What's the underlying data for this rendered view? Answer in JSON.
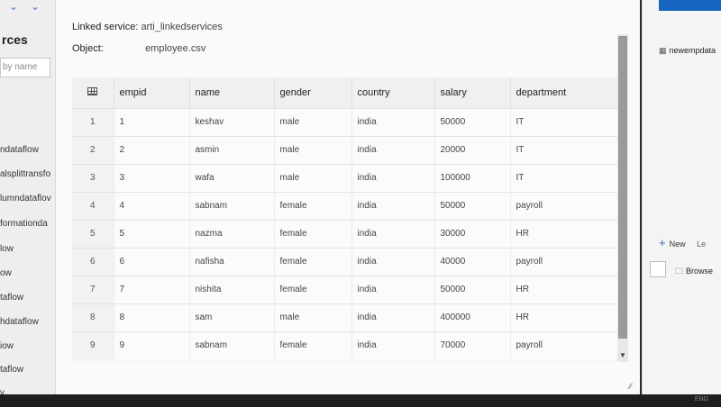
{
  "sidebar": {
    "title": "rces",
    "search_placeholder": "by name",
    "items": [
      "ndataflow",
      "alsplittransfo",
      "lumndataflov",
      "formationda",
      "low",
      "ow",
      "taflow",
      "hdataflow",
      "iow",
      "taflow",
      "y"
    ]
  },
  "dialog": {
    "linked_service_label": "Linked service:",
    "linked_service_value": "arti_linkedservices",
    "object_label": "Object:",
    "object_value": "employee.csv"
  },
  "table": {
    "columns": [
      "empid",
      "name",
      "gender",
      "country",
      "salary",
      "department"
    ],
    "rows": [
      {
        "n": "1",
        "empid": "1",
        "name": "keshav",
        "gender": "male",
        "country": "india",
        "salary": "50000",
        "department": "IT"
      },
      {
        "n": "2",
        "empid": "2",
        "name": "asmin",
        "gender": "male",
        "country": "india",
        "salary": "20000",
        "department": "IT"
      },
      {
        "n": "3",
        "empid": "3",
        "name": "wafa",
        "gender": "male",
        "country": "india",
        "salary": "100000",
        "department": "IT"
      },
      {
        "n": "4",
        "empid": "4",
        "name": "sabnam",
        "gender": "female",
        "country": "india",
        "salary": "50000",
        "department": "payroll"
      },
      {
        "n": "5",
        "empid": "5",
        "name": "nazma",
        "gender": "female",
        "country": "india",
        "salary": "30000",
        "department": "HR"
      },
      {
        "n": "6",
        "empid": "6",
        "name": "nafisha",
        "gender": "female",
        "country": "india",
        "salary": "40000",
        "department": "payroll"
      },
      {
        "n": "7",
        "empid": "7",
        "name": "nishita",
        "gender": "female",
        "country": "india",
        "salary": "50000",
        "department": "HR"
      },
      {
        "n": "8",
        "empid": "8",
        "name": "sam",
        "gender": "male",
        "country": "india",
        "salary": "400000",
        "department": "HR"
      },
      {
        "n": "9",
        "empid": "9",
        "name": "sabnam",
        "gender": "female",
        "country": "india",
        "salary": "70000",
        "department": "payroll"
      }
    ]
  },
  "right_panel": {
    "item_label": "newempdata",
    "new_label": "New",
    "new_extra": "Le",
    "browse_label": "Browse"
  },
  "taskbar": {
    "tray_text": "ENG"
  },
  "icons": [
    "grid-icon",
    "dataset-icon",
    "plus-icon",
    "folder-icon",
    "chevron-down-icon"
  ]
}
